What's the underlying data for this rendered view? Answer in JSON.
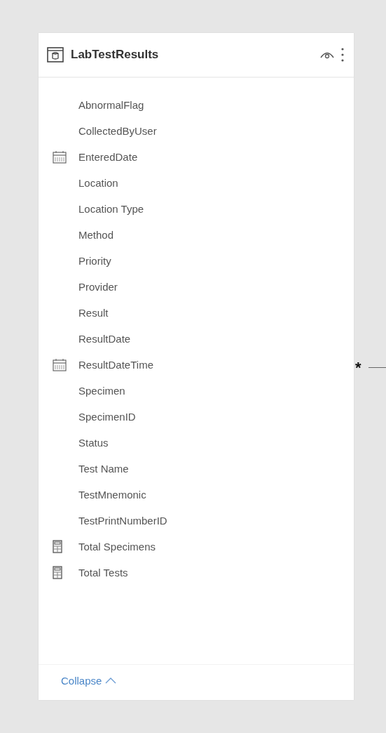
{
  "table": {
    "title": "LabTestResults",
    "fields": [
      {
        "name": "AbnormalFlag",
        "kind": "column"
      },
      {
        "name": "CollectedByUser",
        "kind": "column"
      },
      {
        "name": "EnteredDate",
        "kind": "date"
      },
      {
        "name": "Location",
        "kind": "column"
      },
      {
        "name": "Location Type",
        "kind": "column"
      },
      {
        "name": "Method",
        "kind": "column"
      },
      {
        "name": "Priority",
        "kind": "column"
      },
      {
        "name": "Provider",
        "kind": "column"
      },
      {
        "name": "Result",
        "kind": "column"
      },
      {
        "name": "ResultDate",
        "kind": "column"
      },
      {
        "name": "ResultDateTime",
        "kind": "date"
      },
      {
        "name": "Specimen",
        "kind": "column"
      },
      {
        "name": "SpecimenID",
        "kind": "column"
      },
      {
        "name": "Status",
        "kind": "column"
      },
      {
        "name": "Test Name",
        "kind": "column"
      },
      {
        "name": "TestMnemonic",
        "kind": "column"
      },
      {
        "name": "TestPrintNumberID",
        "kind": "column"
      },
      {
        "name": "Total Specimens",
        "kind": "measure"
      },
      {
        "name": "Total Tests",
        "kind": "measure"
      }
    ],
    "collapse_label": "Collapse"
  },
  "relationship": {
    "cardinality": "*"
  }
}
